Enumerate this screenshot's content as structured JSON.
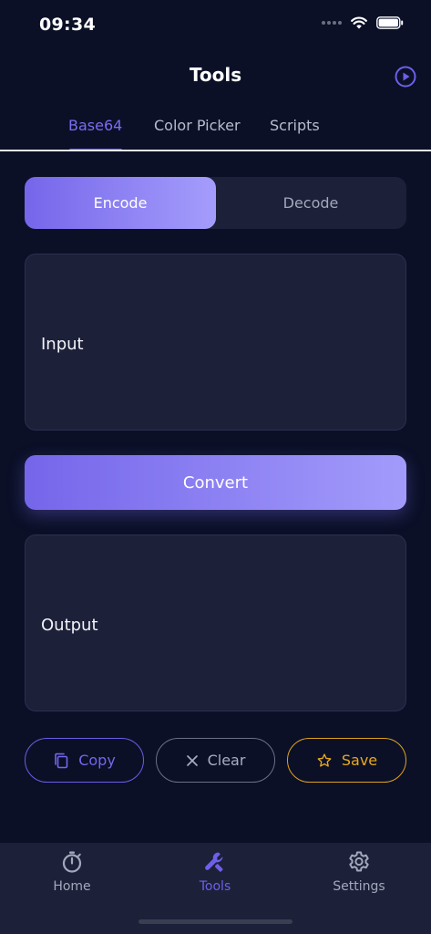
{
  "status_bar": {
    "time": "09:34"
  },
  "header": {
    "title": "Tools"
  },
  "tabs": [
    {
      "label": "Base64",
      "active": true
    },
    {
      "label": "Color Picker",
      "active": false
    },
    {
      "label": "Scripts",
      "active": false
    }
  ],
  "mode": {
    "encode_label": "Encode",
    "decode_label": "Decode",
    "selected": "Encode"
  },
  "input": {
    "placeholder": "Input"
  },
  "convert": {
    "label": "Convert"
  },
  "output": {
    "placeholder": "Output"
  },
  "actions": {
    "copy_label": "Copy",
    "clear_label": "Clear",
    "save_label": "Save"
  },
  "bottom_nav": [
    {
      "label": "Home",
      "icon": "timer-icon",
      "active": false
    },
    {
      "label": "Tools",
      "icon": "wrench-icon",
      "active": true
    },
    {
      "label": "Settings",
      "icon": "gear-icon",
      "active": false
    }
  ],
  "colors": {
    "accent": "#6f5fe8",
    "background": "#0b1027",
    "surface": "#1c2039",
    "save": "#e0a21b"
  }
}
